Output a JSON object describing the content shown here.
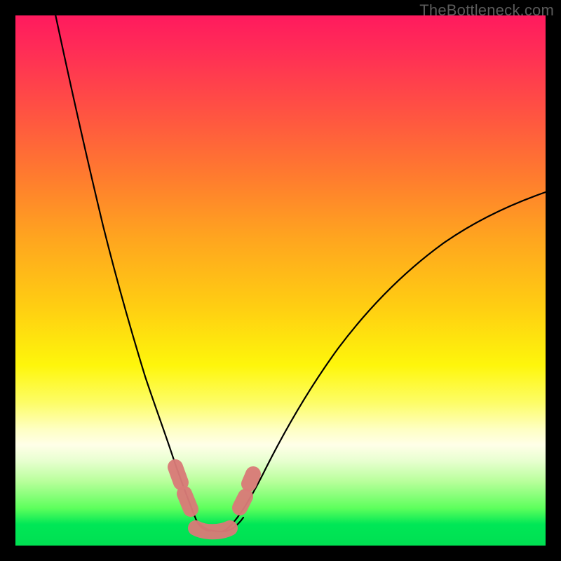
{
  "attribution": "TheBottleneck.com",
  "colors": {
    "frame": "#000000",
    "gradient_top": "#ff1a5e",
    "gradient_mid": "#fef60b",
    "gradient_bottom": "#00df52",
    "curve": "#000000",
    "annotation": "#d87b78"
  },
  "chart_data": {
    "type": "line",
    "title": "",
    "xlabel": "",
    "ylabel": "",
    "xlim": [
      0,
      100
    ],
    "ylim": [
      0,
      100
    ],
    "x": [
      0,
      5,
      10,
      15,
      20,
      22,
      24,
      26,
      28,
      30,
      32,
      34,
      36,
      38,
      40,
      42,
      45,
      50,
      55,
      60,
      65,
      70,
      75,
      80,
      85,
      90,
      95,
      100
    ],
    "series": [
      {
        "name": "bottleneck-curve",
        "values": [
          103,
          92,
          80,
          68,
          55,
          48,
          40,
          31,
          22,
          14,
          8,
          4,
          2,
          2,
          3,
          6,
          10,
          17,
          24,
          31,
          38,
          44,
          50,
          55,
          59,
          62,
          65,
          67
        ]
      }
    ],
    "annotation": {
      "name": "flat-region-marker",
      "x_range": [
        27,
        40
      ],
      "note": "salmon rounded marker highlighting the flat bottom of the curve"
    },
    "note": "Values read approximately from pixel positions; y=0 at bottom, y=100 at top of plot area."
  }
}
